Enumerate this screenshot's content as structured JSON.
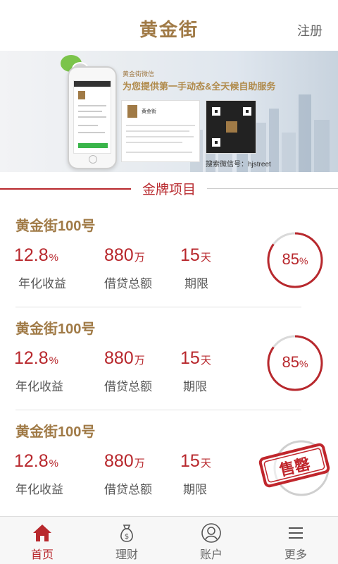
{
  "header": {
    "title": "黄金街",
    "register_label": "注册"
  },
  "banner": {
    "wechat_label": "黄金街微信",
    "slogan": "为您提供第一手动态&全天候自助服务",
    "card_name": "黄金街",
    "search_text": "搜索微信号：hjstreet"
  },
  "section": {
    "title": "金牌项目"
  },
  "products": [
    {
      "name": "黄金街100号",
      "rate": "12.8",
      "rate_unit": "%",
      "rate_label": "年化收益",
      "amount": "880",
      "amount_unit": "万",
      "amount_label": "借贷总额",
      "term": "15",
      "term_unit": "天",
      "term_label": "期限",
      "progress": "85",
      "progress_unit": "%",
      "progress_value": 0.85,
      "sold_out": false
    },
    {
      "name": "黄金街100号",
      "rate": "12.8",
      "rate_unit": "%",
      "rate_label": "年化收益",
      "amount": "880",
      "amount_unit": "万",
      "amount_label": "借贷总额",
      "term": "15",
      "term_unit": "天",
      "term_label": "期限",
      "progress": "85",
      "progress_unit": "%",
      "progress_value": 0.85,
      "sold_out": false
    },
    {
      "name": "黄金街100号",
      "rate": "12.8",
      "rate_unit": "%",
      "rate_label": "年化收益",
      "amount": "880",
      "amount_unit": "万",
      "amount_label": "借贷总额",
      "term": "15",
      "term_unit": "天",
      "term_label": "期限",
      "sold_out": true,
      "sold_out_label": "售罄"
    }
  ],
  "tabbar": [
    {
      "label": "首页",
      "icon": "home-icon",
      "active": true
    },
    {
      "label": "理财",
      "icon": "money-bag-icon",
      "active": false
    },
    {
      "label": "账户",
      "icon": "user-icon",
      "active": false
    },
    {
      "label": "更多",
      "icon": "menu-icon",
      "active": false
    }
  ],
  "colors": {
    "accent": "#b8282d",
    "brand_gold": "#a07a46",
    "ring_track": "#d9d9d9"
  }
}
